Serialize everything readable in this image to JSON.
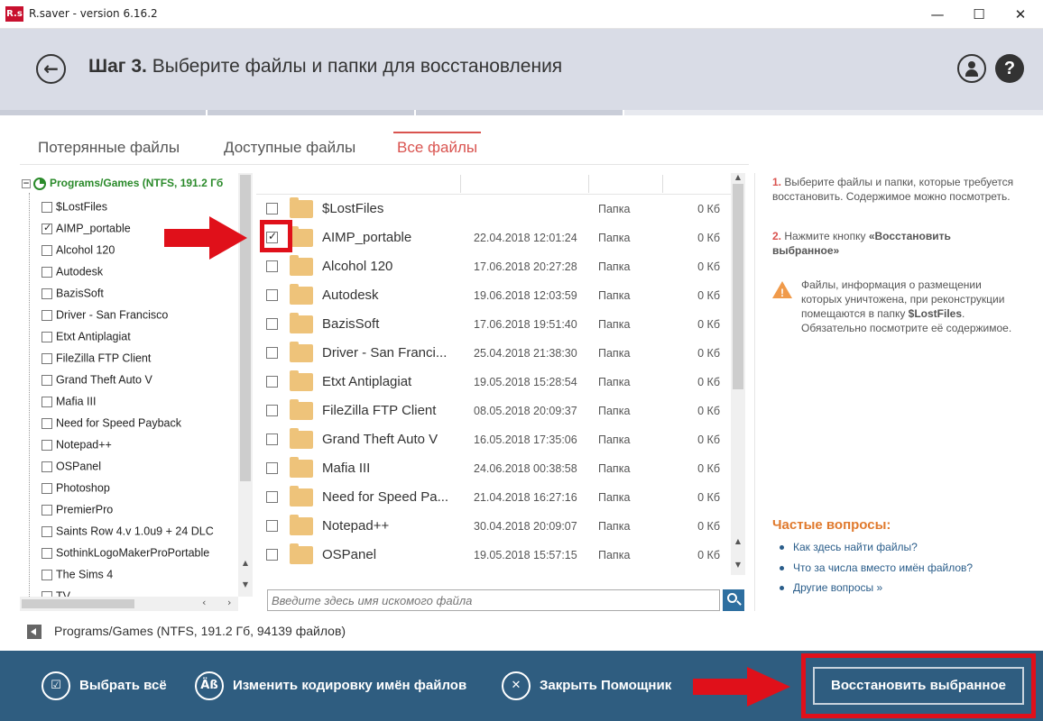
{
  "window": {
    "title": "R.saver - version 6.16.2",
    "logo_text": "R.s",
    "minimize": "—",
    "maximize": "☐",
    "close": "✕"
  },
  "header": {
    "step_label": "Шаг 3.",
    "step_text": "Выберите файлы и папки для восстановления",
    "back_glyph": "←",
    "help_glyph": "?"
  },
  "tabs": [
    {
      "label": "Потерянные файлы",
      "active": false
    },
    {
      "label": "Доступные файлы",
      "active": false
    },
    {
      "label": "Все файлы",
      "active": true
    }
  ],
  "tree": {
    "root_label": "Programs/Games (NTFS, 191.2 Гб",
    "items": [
      {
        "label": "$LostFiles",
        "checked": false
      },
      {
        "label": "AIMP_portable",
        "checked": true
      },
      {
        "label": "Alcohol 120",
        "checked": false
      },
      {
        "label": "Autodesk",
        "checked": false
      },
      {
        "label": "BazisSoft",
        "checked": false
      },
      {
        "label": "Driver - San Francisco",
        "checked": false
      },
      {
        "label": "Etxt Antiplagiat",
        "checked": false
      },
      {
        "label": "FileZilla FTP Client",
        "checked": false
      },
      {
        "label": "Grand Theft Auto V",
        "checked": false
      },
      {
        "label": "Mafia III",
        "checked": false
      },
      {
        "label": "Need for Speed Payback",
        "checked": false
      },
      {
        "label": "Notepad++",
        "checked": false
      },
      {
        "label": "OSPanel",
        "checked": false
      },
      {
        "label": "Photoshop",
        "checked": false
      },
      {
        "label": "PremierPro",
        "checked": false
      },
      {
        "label": "Saints Row 4.v 1.0u9 + 24 DLC",
        "checked": false
      },
      {
        "label": "SothinkLogoMakerProPortable",
        "checked": false
      },
      {
        "label": "The Sims 4",
        "checked": false
      },
      {
        "label": "TV",
        "checked": false
      }
    ]
  },
  "files": [
    {
      "name": "$LostFiles",
      "date": "",
      "type": "Папка",
      "size": "0 Кб",
      "checked": false
    },
    {
      "name": "AIMP_portable",
      "date": "22.04.2018 12:01:24",
      "type": "Папка",
      "size": "0 Кб",
      "checked": true
    },
    {
      "name": "Alcohol 120",
      "date": "17.06.2018 20:27:28",
      "type": "Папка",
      "size": "0 Кб",
      "checked": false
    },
    {
      "name": "Autodesk",
      "date": "19.06.2018 12:03:59",
      "type": "Папка",
      "size": "0 Кб",
      "checked": false
    },
    {
      "name": "BazisSoft",
      "date": "17.06.2018 19:51:40",
      "type": "Папка",
      "size": "0 Кб",
      "checked": false
    },
    {
      "name": "Driver - San Franci...",
      "date": "25.04.2018 21:38:30",
      "type": "Папка",
      "size": "0 Кб",
      "checked": false
    },
    {
      "name": "Etxt Antiplagiat",
      "date": "19.05.2018 15:28:54",
      "type": "Папка",
      "size": "0 Кб",
      "checked": false
    },
    {
      "name": "FileZilla FTP Client",
      "date": "08.05.2018 20:09:37",
      "type": "Папка",
      "size": "0 Кб",
      "checked": false
    },
    {
      "name": "Grand Theft Auto V",
      "date": "16.05.2018 17:35:06",
      "type": "Папка",
      "size": "0 Кб",
      "checked": false
    },
    {
      "name": "Mafia III",
      "date": "24.06.2018 00:38:58",
      "type": "Папка",
      "size": "0 Кб",
      "checked": false
    },
    {
      "name": "Need for Speed Pa...",
      "date": "21.04.2018 16:27:16",
      "type": "Папка",
      "size": "0 Кб",
      "checked": false
    },
    {
      "name": "Notepad++",
      "date": "30.04.2018 20:09:07",
      "type": "Папка",
      "size": "0 Кб",
      "checked": false
    },
    {
      "name": "OSPanel",
      "date": "19.05.2018 15:57:15",
      "type": "Папка",
      "size": "0 Кб",
      "checked": false
    }
  ],
  "search": {
    "placeholder": "Введите здесь имя искомого файла"
  },
  "info": {
    "step1_num": "1.",
    "step1_text": "Выберите файлы и папки, которые требуется восстановить. Содержимое можно посмотреть.",
    "step2_num": "2.",
    "step2_text_a": "Нажмите кнопку ",
    "step2_text_b": "«Восстановить выбранное»",
    "warn_a": "Файлы, информация о размещении которых уничтожена, при реконструкции помещаются в папку ",
    "warn_b": "$LostFiles",
    "warn_c": ". Обязательно посмотрите её содержимое.",
    "faq_title": "Частые вопросы:",
    "faq": [
      "Как здесь найти файлы?",
      "Что за числа вместо имён файлов?",
      "Другие вопросы »"
    ]
  },
  "status_path": "Programs/Games (NTFS, 191.2 Гб, 94139 файлов)",
  "bottom": {
    "select_all": "Выбрать всё",
    "select_all_glyph": "☑",
    "change_encoding": "Изменить кодировку имён файлов",
    "change_encoding_glyph": "Äß",
    "close_wizard": "Закрыть Помощник",
    "close_wizard_glyph": "✕",
    "restore": "Восстановить выбранное"
  },
  "colors": {
    "accent_red": "#d9534f",
    "bottom_bar": "#2f5d80",
    "annotation_red": "#e0101a",
    "folder": "#eec37a"
  }
}
